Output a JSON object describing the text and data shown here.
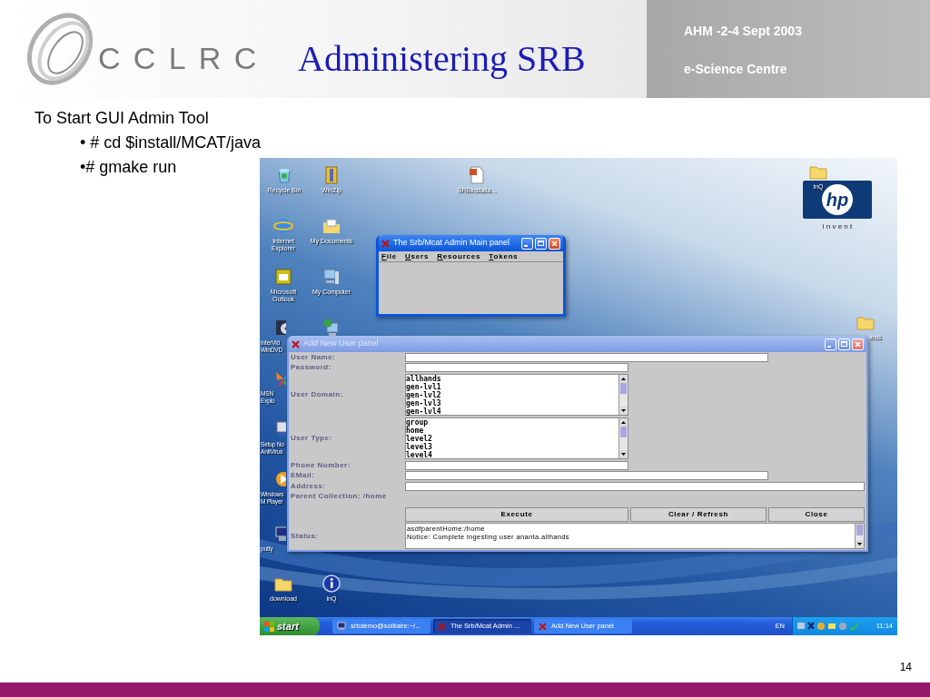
{
  "header": {
    "logo_text": "CCLRC",
    "title": "Administering SRB",
    "date": "AHM -2-4 Sept 2003",
    "org": "e-Science Centre"
  },
  "body": {
    "heading": "To Start GUI Admin Tool",
    "bullets": [
      "• # cd $install/MCAT/java",
      "•# gmake run"
    ]
  },
  "desktop": {
    "wallpaper_logo": {
      "mark": "hp",
      "tagline": "i n v e n t"
    },
    "icons": [
      {
        "kind": "bin",
        "label": "Recycle Bin"
      },
      {
        "kind": "archive",
        "label": "WinZip"
      },
      {
        "kind": "document",
        "label": "SRBInstalla..."
      },
      {
        "kind": "browser",
        "label": "Internet Explorer"
      },
      {
        "kind": "documents",
        "label": "My Documents"
      },
      {
        "kind": "mail",
        "label": "Microsoft Outlook"
      },
      {
        "kind": "computer",
        "label": "My Computer"
      },
      {
        "kind": "disc",
        "label": "InterVid WinDVD"
      },
      {
        "kind": "network"
      },
      {
        "kind": "butterfly",
        "label": "MSN Explo"
      },
      {
        "kind": "setup",
        "label": "Setup No AntiVirus"
      },
      {
        "kind": "player",
        "label": "Windows M Player"
      },
      {
        "kind": "terminal",
        "label": "putty"
      },
      {
        "kind": "folder",
        "label": "download"
      },
      {
        "kind": "info",
        "label": "inQ"
      },
      {
        "kind": "folder",
        "label": "inQ"
      },
      {
        "kind": "folder",
        "label": "ands"
      }
    ],
    "windows": [
      {
        "kind": "menu",
        "title": "The Srb/Mcat Admin Main panel",
        "active": true,
        "menu": [
          "File",
          "Users",
          "Resources",
          "Tokens"
        ]
      },
      {
        "kind": "form",
        "title": "Add New User panel",
        "active": false,
        "fields": [
          {
            "kind": "text",
            "label": "User Name:"
          },
          {
            "kind": "text",
            "label": "Password:"
          },
          {
            "kind": "list",
            "label": "User Domain:",
            "options": [
              "allhands",
              "gen-lvl1",
              "gen-lvl2",
              "gen-lvl3",
              "gen-lvl4"
            ]
          },
          {
            "kind": "list",
            "label": "User Type:",
            "options": [
              "group",
              "home",
              "level2",
              "level3",
              "level4"
            ]
          },
          {
            "kind": "text",
            "label": "Phone Number:"
          },
          {
            "kind": "text",
            "label": "EMail:"
          },
          {
            "kind": "text",
            "label": "Address:"
          },
          {
            "kind": "info",
            "label": "Parent Collection: /home"
          }
        ],
        "buttons": [
          "Execute",
          "Clear / Refresh",
          "Close"
        ],
        "status": {
          "label": "Status:",
          "lines": [
            "asdfparentHome:/home",
            "Notice: Complete ingesting user ananta.allhands"
          ]
        }
      }
    ],
    "taskbar": {
      "start": "start",
      "tasks": [
        {
          "kind": "terminal",
          "label": "srbdemo@solitaire:~/...",
          "selected": false
        },
        {
          "kind": "java",
          "label": "The Srb/Mcat Admin ...",
          "selected": true
        },
        {
          "kind": "java",
          "label": "Add New User panel",
          "selected": false
        }
      ],
      "language": "EN",
      "clock": "11:14"
    }
  },
  "page_number": "14"
}
